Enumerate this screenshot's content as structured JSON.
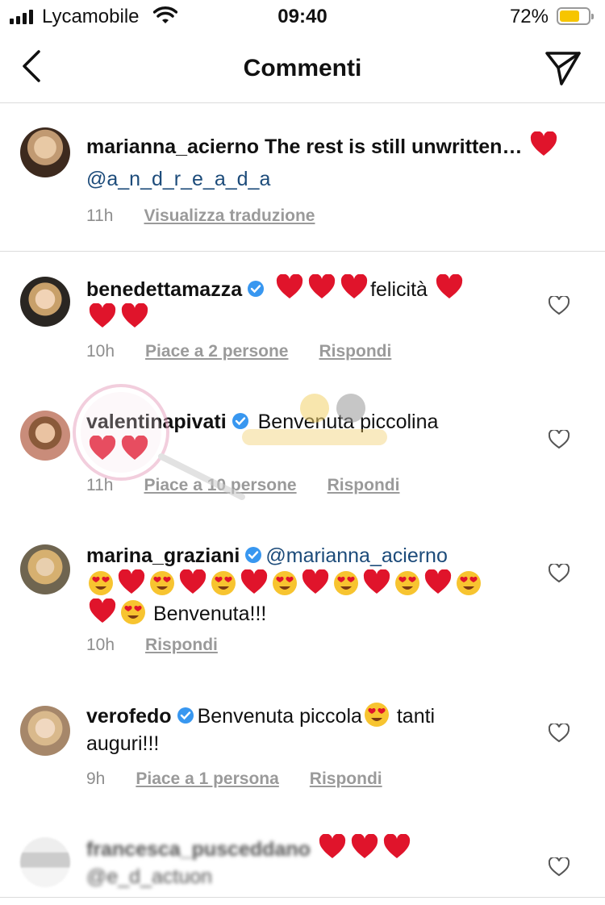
{
  "status_bar": {
    "carrier": "Lycamobile",
    "time": "09:40",
    "battery_percent": "72%",
    "battery_level": 0.72
  },
  "header": {
    "title": "Commenti",
    "back_icon": "chevron-left-icon",
    "send_icon": "paper-plane-icon"
  },
  "caption": {
    "username": "marianna_acierno",
    "text": "The rest is still unwritten…",
    "emoji": "heart",
    "mention": "@a_n_d_r_e_a_d_a",
    "time": "11h",
    "translate_label": "Visualizza traduzione"
  },
  "comments": [
    {
      "username": "benedettamazza",
      "verified": true,
      "text": "felicità",
      "time": "10h",
      "likes_label": "Piace a 2 persone",
      "reply_label": "Rispondi"
    },
    {
      "username": "valentinapivati",
      "verified": true,
      "text": "Benvenuta piccolina",
      "time": "11h",
      "likes_label": "Piace a 10 persone",
      "reply_label": "Rispondi"
    },
    {
      "username": "marina_graziani",
      "verified": true,
      "mention": "@marianna_acierno",
      "text": "Benvenuta!!!",
      "time": "10h",
      "reply_label": "Rispondi"
    },
    {
      "username": "verofedo",
      "verified": true,
      "text_before": "Benvenuta piccola",
      "text_after": "tanti",
      "text_line2": "auguri!!!",
      "time": "9h",
      "likes_label": "Piace a 1 persona",
      "reply_label": "Rispondi"
    },
    {
      "username": "francesca_pusceddano",
      "verified": false,
      "mention": "@e_d_actuon"
    }
  ],
  "colors": {
    "heart": "#e0142b",
    "verified": "#3897f0",
    "mention": "#1c4b7a",
    "meta": "#8e8e8e",
    "divider": "#dbdbdb"
  }
}
